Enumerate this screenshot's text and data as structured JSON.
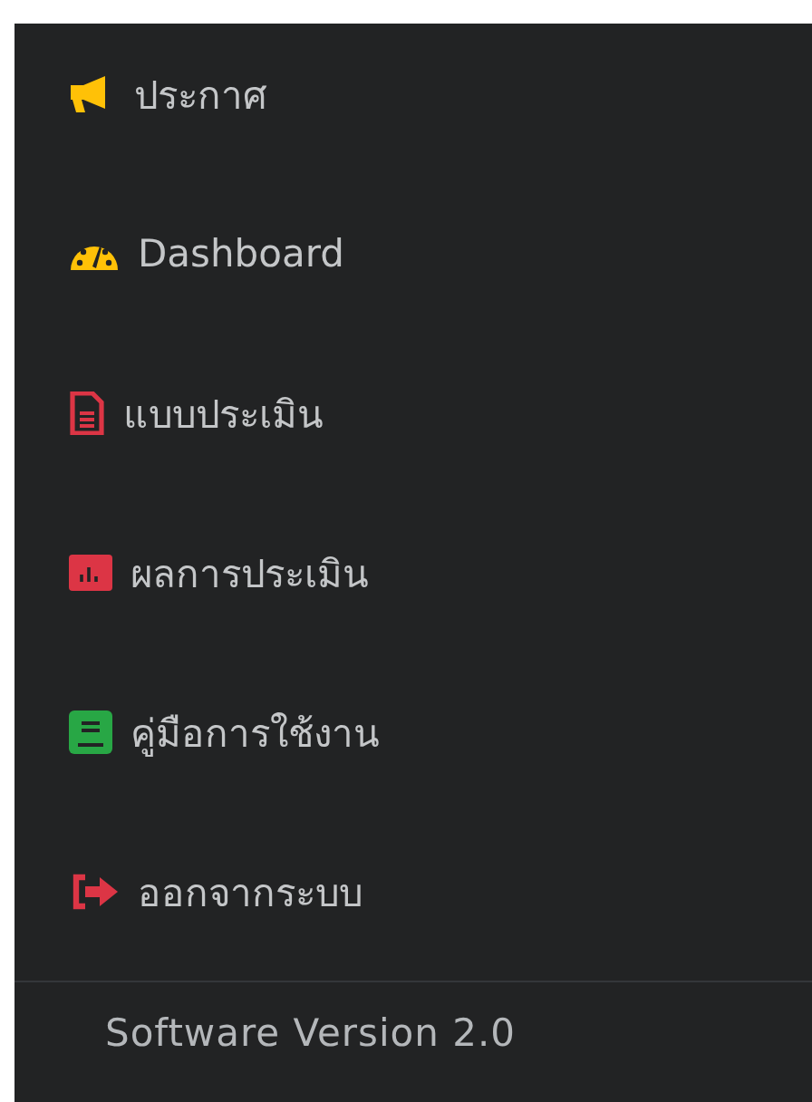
{
  "menu": [
    {
      "label": "ประกาศ",
      "kind": "megaphone",
      "color": "#ffc107"
    },
    {
      "label": "Dashboard",
      "kind": "gauge",
      "color": "#ffc107"
    },
    {
      "label": "แบบประเมิน",
      "kind": "file",
      "color": "#dc3545"
    },
    {
      "label": "ผลการประเมิน",
      "kind": "chart",
      "color": "#dc3545"
    },
    {
      "label": "คู่มือการใช้งาน",
      "kind": "book",
      "color": "#28a745"
    },
    {
      "label": "ออกจากระบบ",
      "kind": "exit",
      "color": "#dc3545"
    }
  ],
  "footer": {
    "version": "Software Version 2.0"
  }
}
